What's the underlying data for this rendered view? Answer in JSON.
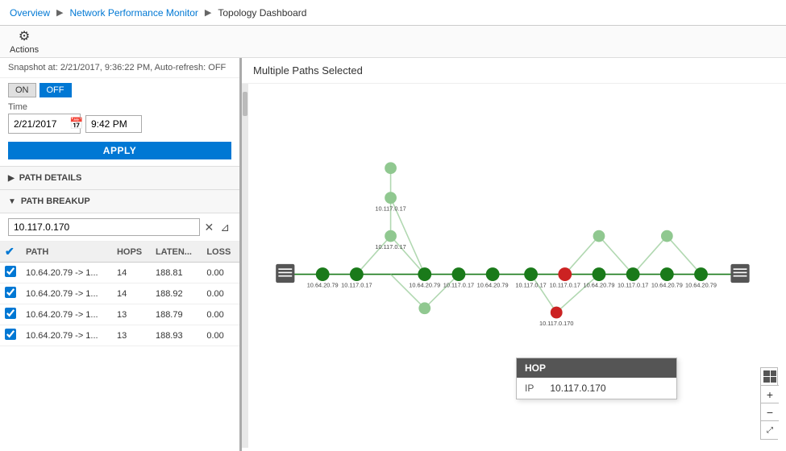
{
  "breadcrumb": {
    "items": [
      {
        "label": "Overview",
        "active": false
      },
      {
        "label": "Network Performance Monitor",
        "active": false
      },
      {
        "label": "Topology Dashboard",
        "active": true
      }
    ]
  },
  "actions": {
    "label": "Actions"
  },
  "snapshot": {
    "text": "Snapshot at: 2/21/2017, 9:36:22 PM, Auto-refresh: OFF"
  },
  "toggle": {
    "on_label": "ON",
    "off_label": "OFF"
  },
  "time": {
    "label": "Time",
    "date_value": "2/21/2017",
    "time_value": "9:42 PM"
  },
  "apply_btn": "APPLY",
  "path_details": {
    "label": "PATH DETAILS"
  },
  "path_breakup": {
    "label": "PATH BREAKUP",
    "filter_value": "10.117.0.170",
    "columns": [
      "",
      "PATH",
      "HOPS",
      "LATEN...",
      "LOSS"
    ],
    "rows": [
      {
        "checked": true,
        "path": "10.64.20.79 -> 1...",
        "hops": "14",
        "latency": "188.81",
        "loss": "0.00"
      },
      {
        "checked": true,
        "path": "10.64.20.79 -> 1...",
        "hops": "14",
        "latency": "188.92",
        "loss": "0.00"
      },
      {
        "checked": true,
        "path": "10.64.20.79 -> 1...",
        "hops": "13",
        "latency": "188.79",
        "loss": "0.00"
      },
      {
        "checked": true,
        "path": "10.64.20.79 -> 1...",
        "hops": "13",
        "latency": "188.93",
        "loss": "0.00"
      }
    ]
  },
  "main_panel": {
    "title": "Multiple Paths Selected"
  },
  "hop_tooltip": {
    "header": "HOP",
    "label": "IP",
    "value": "10.117.0.170"
  },
  "zoom_controls": {
    "plus": "+",
    "minus": "−"
  }
}
